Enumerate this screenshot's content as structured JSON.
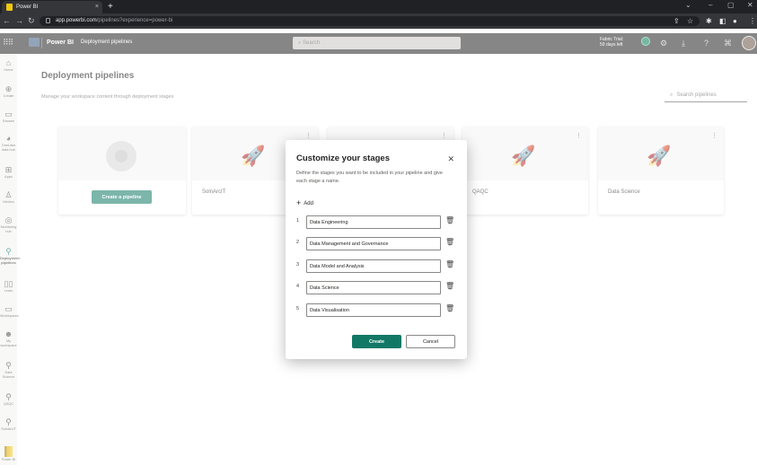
{
  "browser": {
    "tab_title": "Power BI",
    "tab_close": "×",
    "new_tab": "+",
    "url_host": "app.powerbi.com",
    "url_path": "/pipelines?experience=power-bi"
  },
  "header": {
    "app_name": "Power BI",
    "breadcrumb": "Deployment pipelines",
    "search_placeholder": "Search",
    "trial_line1": "Fabric Trial:",
    "trial_line2": "59 days left"
  },
  "nav": {
    "items": [
      {
        "label": "Home"
      },
      {
        "label": "Create"
      },
      {
        "label": "Browse"
      },
      {
        "label": "OneLake\ndata hub"
      },
      {
        "label": "Apps"
      },
      {
        "label": "Metrics"
      },
      {
        "label": "Monitoring\nhub"
      },
      {
        "label": "Deployment\npipelines"
      },
      {
        "label": "Learn"
      },
      {
        "label": "Workspaces"
      },
      {
        "label": "My\nworkspace"
      },
      {
        "label": "Data\nScience"
      },
      {
        "label": "QAQC"
      },
      {
        "label": "SolnArcIT"
      },
      {
        "label": "Power BI"
      }
    ]
  },
  "main": {
    "title": "Deployment pipelines",
    "subtitle": "Manage your workspace content through deployment stages",
    "search_placeholder": "Search pipelines",
    "create_pipeline_label": "Create a pipeline",
    "cards": [
      {
        "name": "SolnArcIT"
      },
      {
        "name": "QAQC"
      },
      {
        "name": "Data Science"
      }
    ]
  },
  "modal": {
    "title": "Customize your stages",
    "description": "Define the stages you want to be included in your pipeline and give each stage a name.",
    "add_label": "Add",
    "stages": [
      {
        "num": "1",
        "value": "Data Engineering"
      },
      {
        "num": "2",
        "value": "Data Management and Governance"
      },
      {
        "num": "3",
        "value": "Data Model and Analysis"
      },
      {
        "num": "4",
        "value": "Data Science"
      },
      {
        "num": "5",
        "value": "Data Visualisation"
      }
    ],
    "create_label": "Create",
    "cancel_label": "Cancel"
  },
  "colors": {
    "accent": "#117865",
    "app_header": "#252423",
    "nav_bg": "#f3f2f1"
  }
}
